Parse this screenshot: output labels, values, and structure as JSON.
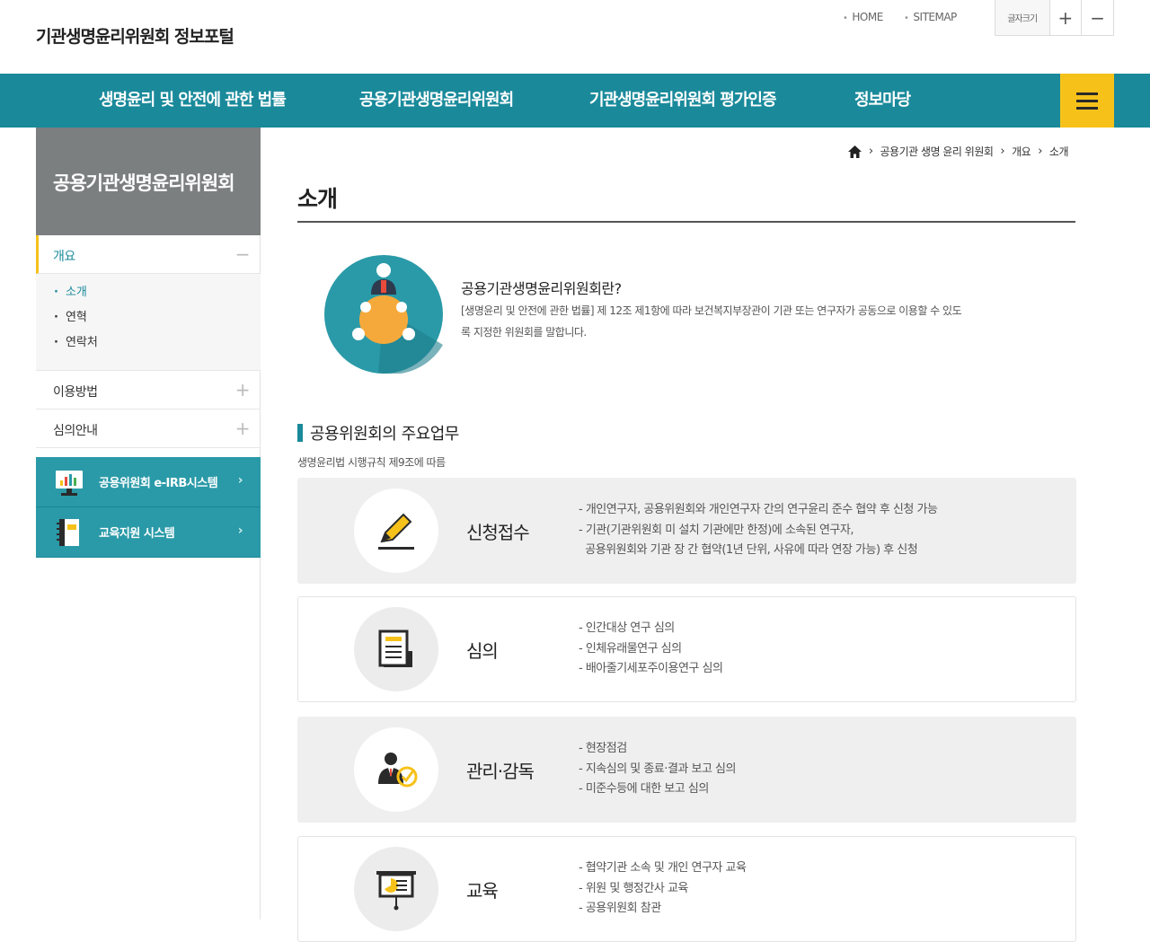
{
  "header": {
    "site_title": "기관생명윤리위원회 정보포털",
    "util_links": [
      "HOME",
      "SITEMAP"
    ],
    "fontsize_label": "글자크기",
    "fontsize_plus": "+",
    "fontsize_minus": "−"
  },
  "gnb": {
    "items": [
      "생명윤리 및 안전에 관한 법률",
      "공용기관생명윤리위원회",
      "기관생명윤리위원회 평가인증",
      "정보마당"
    ],
    "menu_button_icon": "hamburger-icon"
  },
  "sidebar": {
    "title": "공용기관생명윤리위원회",
    "items": [
      {
        "label": "개요",
        "toggle": "−"
      },
      {
        "label": "이용방법",
        "toggle": "+"
      },
      {
        "label": "심의안내",
        "toggle": "+"
      }
    ],
    "sub_items": [
      "소개",
      "연혁",
      "연락처"
    ],
    "systems": [
      {
        "label": "공용위원회 e-IRB시스템",
        "icon": "bar-chart-monitor-icon"
      },
      {
        "label": "교육지원 시스템",
        "icon": "notebook-icon"
      }
    ],
    "arrow": "›"
  },
  "breadcrumb": {
    "home_icon": "home-icon",
    "items": [
      "공용기관 생명 윤리 위원회",
      "개요",
      "소개"
    ]
  },
  "content": {
    "page_title": "소개",
    "intro": {
      "heading": "공용기관생명윤리위원회란?",
      "text": "[생명윤리 및 안전에 관한 법률] 제 12조 제1항에 따라 보건복지부장관이 기관 또는 연구자가 공동으로 이용할 수 있도록 지정한 위원회를 말합니다.",
      "icon": "meeting-table-icon"
    },
    "section_title": "공용위원회의 주요업무",
    "section_sub": "생명윤리법 시행규칙 제9조에 따름",
    "duties": [
      {
        "title": "신청접수",
        "icon": "pencil-icon",
        "lines": [
          "- 개인연구자, 공용위원회와 개인연구자 간의 연구윤리 준수 협약 후 신청 가능",
          "- 기관(기관위원회 미 설치 기관에만 한정)에 소속된 연구자,",
          "  공용위원회와 기관 장 간 협약(1년 단위, 사유에 따라 연장 가능) 후 신청"
        ]
      },
      {
        "title": "심의",
        "icon": "document-icon",
        "lines": [
          "- 인간대상 연구 심의",
          "- 인체유래물연구 심의",
          "- 배아줄기세포주이용연구 심의"
        ]
      },
      {
        "title": "관리·감독",
        "icon": "supervisor-check-icon",
        "lines": [
          "- 현장점검",
          "- 지속심의 및 종료·결과 보고 심의",
          "- 미준수등에 대한 보고 심의"
        ]
      },
      {
        "title": "교육",
        "icon": "presentation-board-icon",
        "lines": [
          "- 협약기관 소속 및 개인 연구자 교육",
          "- 위원 및 행정간사 교육",
          "- 공용위원회 참관"
        ]
      }
    ]
  },
  "colors": {
    "primary": "#1a8a9b",
    "accent": "#f6c21a",
    "sidebar_title_bg": "#7c7f80",
    "system_button_bg": "#2a9aa8"
  }
}
